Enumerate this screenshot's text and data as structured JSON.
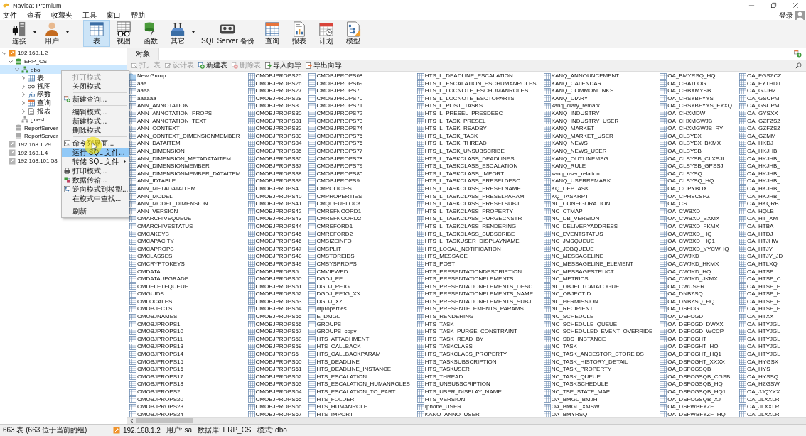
{
  "window": {
    "title": "Navicat Premium"
  },
  "menu_bar": [
    "文件",
    "查看",
    "收藏夹",
    "工具",
    "窗口",
    "帮助"
  ],
  "login": {
    "label": "登录"
  },
  "toolbar": {
    "groups": [
      [
        {
          "label": "连接",
          "dropdown": true,
          "selected": false
        },
        {
          "label": "用户",
          "dropdown": true,
          "selected": false
        }
      ],
      [
        {
          "label": "表",
          "dropdown": false,
          "selected": true
        },
        {
          "label": "视图",
          "dropdown": false,
          "selected": false
        },
        {
          "label": "函数",
          "dropdown": false,
          "selected": false
        },
        {
          "label": "其它",
          "dropdown": true,
          "selected": false
        },
        {
          "label": "SQL Server 备份",
          "dropdown": false,
          "selected": false
        },
        {
          "label": "查询",
          "dropdown": false,
          "selected": false
        },
        {
          "label": "报表",
          "dropdown": false,
          "selected": false
        },
        {
          "label": "计划",
          "dropdown": false,
          "selected": false
        },
        {
          "label": "模型",
          "dropdown": false,
          "selected": false
        }
      ]
    ]
  },
  "tree": {
    "items": [
      {
        "label": "192.168.1.2",
        "kind": "server",
        "connected": true,
        "expanded": true,
        "selected": false,
        "children": [
          {
            "label": "ERP_CS",
            "kind": "database",
            "connected": true,
            "expanded": true,
            "selected": false,
            "children": [
              {
                "label": "dbo",
                "kind": "schema",
                "connected": true,
                "expanded": true,
                "selected": true,
                "children": [
                  {
                    "label": "表",
                    "kind": "tables",
                    "expanded": false,
                    "selected": false
                  },
                  {
                    "label": "视图",
                    "kind": "views",
                    "expanded": false,
                    "selected": false
                  },
                  {
                    "label": "函数",
                    "kind": "functions",
                    "expanded": false,
                    "selected": false
                  },
                  {
                    "label": "查询",
                    "kind": "queries",
                    "expanded": false,
                    "selected": false
                  },
                  {
                    "label": "报表",
                    "kind": "reports",
                    "expanded": false,
                    "selected": false
                  }
                ]
              },
              {
                "label": "guest",
                "kind": "schema",
                "connected": false,
                "selected": false
              }
            ]
          },
          {
            "label": "ReportServer",
            "kind": "database",
            "connected": false,
            "selected": false
          },
          {
            "label": "ReportServer",
            "kind": "database",
            "connected": false,
            "selected": false
          }
        ]
      },
      {
        "label": "192.168.1.29",
        "kind": "server",
        "connected": false,
        "selected": false
      },
      {
        "label": "192.168.1.4",
        "kind": "server",
        "connected": false,
        "selected": false
      },
      {
        "label": "192.168.101.58",
        "kind": "server",
        "connected": false,
        "selected": false
      }
    ]
  },
  "context_menu": [
    {
      "kind": "item",
      "label": "打开模式",
      "disabled": true,
      "selected": false
    },
    {
      "kind": "item",
      "label": "关闭模式",
      "disabled": false,
      "selected": false
    },
    {
      "kind": "separator"
    },
    {
      "kind": "item",
      "label": "新建查询...",
      "disabled": false,
      "selected": false
    },
    {
      "kind": "separator"
    },
    {
      "kind": "item",
      "label": "编辑模式...",
      "disabled": false,
      "selected": false
    },
    {
      "kind": "item",
      "label": "新建模式...",
      "disabled": false,
      "selected": false
    },
    {
      "kind": "item",
      "label": "删除模式",
      "disabled": false,
      "selected": false
    },
    {
      "kind": "separator"
    },
    {
      "kind": "item",
      "label": "命令列界面...",
      "disabled": false,
      "selected": false
    },
    {
      "kind": "item",
      "label": "运行 SQL 文件...",
      "disabled": false,
      "selected": true
    },
    {
      "kind": "item",
      "label": "转储 SQL 文件",
      "submenu": true,
      "disabled": false,
      "selected": false
    },
    {
      "kind": "item",
      "label": "打印模式...",
      "disabled": false,
      "selected": false
    },
    {
      "kind": "item",
      "label": "数据传输...",
      "disabled": false,
      "selected": false
    },
    {
      "kind": "item",
      "label": "逆向模式到模型...",
      "disabled": false,
      "selected": false
    },
    {
      "kind": "item",
      "label": "在模式中查找...",
      "disabled": false,
      "selected": false
    },
    {
      "kind": "separator"
    },
    {
      "kind": "item",
      "label": "刷新",
      "disabled": false,
      "selected": false
    }
  ],
  "tabs": [
    {
      "label": "对象",
      "selected": true
    }
  ],
  "object_toolbar": [
    {
      "label": "打开表",
      "disabled": true
    },
    {
      "label": "设计表",
      "disabled": true
    },
    {
      "label": "新建表",
      "disabled": false
    },
    {
      "label": "删除表",
      "disabled": true
    },
    {
      "label": "导入向导",
      "disabled": false
    },
    {
      "label": "导出向导",
      "disabled": false
    }
  ],
  "objects": {
    "groups": [
      "New Group"
    ],
    "tables": [
      "aaa",
      "aaaa",
      "aaaaaa",
      "ANN_ANNOTATION",
      "ANN_ANNOTATION_PROPS",
      "ANN_ANNOTATION_TEXT",
      "ANN_CONTEXT",
      "ANN_CONTEXT_DIMENSIONMEMBER",
      "ANN_DATAITEM",
      "ANN_DIMENSION",
      "ANN_DIMENSION_METADATAITEM",
      "ANN_DIMENSIONMEMBER",
      "ANN_DIMENSIONMEMBER_DATAITEM",
      "ANN_IDTABLE",
      "ANN_METADATAITEM",
      "ANN_MODEL",
      "ANN_MODEL_DIMENSION",
      "ANN_VERSION",
      "CMARCHIVEQUEUE",
      "CMARCHIVESTATUS",
      "CMCAKEYS",
      "CMCAPACITY",
      "CMCAPROPS",
      "CMCLASSES",
      "CMCRYPTOKEYS",
      "CMDATA",
      "CMDATAUPGRADE",
      "CMDELETEQUEUE",
      "CMGUIDS",
      "CMLOCALES",
      "CMOBJECTS",
      "CMOBJNAMES",
      "CMOBJPROPS1",
      "CMOBJPROPS10",
      "CMOBJPROPS11",
      "CMOBJPROPS13",
      "CMOBJPROPS14",
      "CMOBJPROPS15",
      "CMOBJPROPS16",
      "CMOBJPROPS17",
      "CMOBJPROPS18",
      "CMOBJPROPS2",
      "CMOBJPROPS20",
      "CMOBJPROPS23",
      "CMOBJPROPS24",
      "CMOBJPROPS25",
      "CMOBJPROPS26",
      "CMOBJPROPS27",
      "CMOBJPROPS28",
      "CMOBJPROPS3",
      "CMOBJPROPS30",
      "CMOBJPROPS31",
      "CMOBJPROPS32",
      "CMOBJPROPS33",
      "CMOBJPROPS34",
      "CMOBJPROPS35",
      "CMOBJPROPS36",
      "CMOBJPROPS37",
      "CMOBJPROPS38",
      "CMOBJPROPS39",
      "CMOBJPROPS4",
      "CMOBJPROPS40",
      "CMOBJPROPS41",
      "CMOBJPROPS42",
      "CMOBJPROPS43",
      "CMOBJPROPS44",
      "CMOBJPROPS45",
      "CMOBJPROPS46",
      "CMOBJPROPS47",
      "CMOBJPROPS48",
      "CMOBJPROPS49",
      "CMOBJPROPS5",
      "CMOBJPROPS50",
      "CMOBJPROPS51",
      "CMOBJPROPS52",
      "CMOBJPROPS53",
      "CMOBJPROPS54",
      "CMOBJPROPS55",
      "CMOBJPROPS56",
      "CMOBJPROPS57",
      "CMOBJPROPS58",
      "CMOBJPROPS59",
      "CMOBJPROPS6",
      "CMOBJPROPS60",
      "CMOBJPROPS61",
      "CMOBJPROPS62",
      "CMOBJPROPS63",
      "CMOBJPROPS64",
      "CMOBJPROPS65",
      "CMOBJPROPS66",
      "CMOBJPROPS67",
      "CMOBJPROPS68",
      "CMOBJPROPS69",
      "CMOBJPROPS7",
      "CMOBJPROPS70",
      "CMOBJPROPS71",
      "CMOBJPROPS72",
      "CMOBJPROPS73",
      "CMOBJPROPS74",
      "CMOBJPROPS75",
      "CMOBJPROPS76",
      "CMOBJPROPS77",
      "CMOBJPROPS78",
      "CMOBJPROPS79",
      "CMOBJPROPS80",
      "CMOBJPROPS9",
      "CMPOLICIES",
      "CMPROPERTIES",
      "CMQUEUELOCK",
      "CMREFNOORD1",
      "CMREFNOORD2",
      "CMREFORD1",
      "CMREFORD2",
      "CMSIZEINFO",
      "CMSPLIT",
      "CMSTOREIDS",
      "CMSYSPROPS",
      "CMVIEWED",
      "DGDJ_PF",
      "DGDJ_PFJG",
      "DGDJ_PFJG_XX",
      "DGDJ_XZ",
      "dtproperties",
      "E_DMGL",
      "GROUPS",
      "GROUPS_copy",
      "HTS_ATTACHMENT",
      "HTS_CALLBACK",
      "HTS_CALLBACKPARAM",
      "HTS_DEADLINE",
      "HTS_DEADLINE_INSTANCE",
      "HTS_ESCALATION",
      "HTS_ESCALATION_HUMANROLES",
      "HTS_ESCALATION_TO_PART",
      "HTS_FOLDER",
      "HTS_HUMANROLE",
      "HTS_IMPORT",
      "HTS_L_DEADLINE_ESCALATION",
      "HTS_L_ESCALATION_ESCHUMANROLES",
      "HTS_L_LOCNOTE_ESCHUMANROLES",
      "HTS_L_LOCNOTE_ESCTOPARTS",
      "HTS_L_POST_TASKS",
      "HTS_L_PRESEL_PRESDESC",
      "HTS_L_TASK_PRESEL",
      "HTS_L_TASK_READBY",
      "HTS_L_TASK_TASK",
      "HTS_L_TASK_THREAD",
      "HTS_L_TASK_UNSUBSCRIBE",
      "HTS_L_TASKCLASS_DEADLINES",
      "HTS_L_TASKCLASS_ESCALATION",
      "HTS_L_TASKCLASS_IMPORT",
      "HTS_L_TASKCLASS_PRESELDESC",
      "HTS_L_TASKCLASS_PRESELNAME",
      "HTS_L_TASKCLASS_PRESELPARAM",
      "HTS_L_TASKCLASS_PRESELSUBJ",
      "HTS_L_TASKCLASS_PROPERTY",
      "HTS_L_TASKCLASS_PURGECNSTR",
      "HTS_L_TASKCLASS_RENDERING",
      "HTS_L_TASKCLASS_SUBSCRIBE",
      "HTS_L_TASKUSER_DISPLAYNAME",
      "HTS_LOCAL_NOTIFICATION",
      "HTS_MESSAGE",
      "HTS_POST",
      "HTS_PRESENTATIONDESCRIPTION",
      "HTS_PRESENTATIONELEMENTS",
      "HTS_PRESENTATIONELEMENTS_DESC",
      "HTS_PRESENTATIONELEMENTS_NAME",
      "HTS_PRESENTATIONELEMENTS_SUBJ",
      "HTS_PRESENTELEMENTS_PARAMS",
      "HTS_RENDERING",
      "HTS_TASK",
      "HTS_TASK_PURGE_CONSTRAINT",
      "HTS_TASK_READ_BY",
      "HTS_TASKCLASS",
      "HTS_TASKCLASS_PROPERTY",
      "HTS_TASKSUBSCRIPTION",
      "HTS_TASKUSER",
      "HTS_THREAD",
      "HTS_UNSUBSCRIPTION",
      "HTS_USER_DISPLAY_NAME",
      "HTS_VERSION",
      "Iphone_USER",
      "KANQ_ANNO_USER",
      "KANQ_ANNOUNCEMENT",
      "KANQ_CALENDAR",
      "KANQ_COMMONLINKS",
      "KANQ_DIARY",
      "kanq_diary_remark",
      "KANQ_INDUSTRY",
      "KANQ_INDUSTRY_USER",
      "KANQ_MARKET",
      "KANQ_MARKET_USER",
      "KANQ_NEWS",
      "KANQ_NEWS_USER",
      "KANQ_OUTLINEMSG",
      "KANQ_RULE",
      "kanq_user_relation",
      "KANQ_USERREMARK",
      "KQ_DEPTASK",
      "KQ_TASKRPT",
      "NC_CONFIGURATION",
      "NC_CTMAP",
      "NC_DB_VERSION",
      "NC_DELIVERYADDRESS",
      "NC_EVENTSTATUS",
      "NC_JMSQUEUE",
      "NC_JOBQUEUE",
      "NC_MESSAGELINE",
      "NC_MESSAGELINE_ELEMENT",
      "NC_MESSAGESTRUCT",
      "NC_METRICS",
      "NC_OBJECTCATALOGUE",
      "NC_OBJECTID",
      "NC_PERMISSION",
      "NC_RECIPIENT",
      "NC_SCHEDULE",
      "NC_SCHEDULE_QUEUE",
      "NC_SCHEDULED_EVENT_OVERRIDE",
      "NC_SDS_INSTANCE",
      "NC_TASK",
      "NC_TASK_ANCESTOR_STOREIDS",
      "NC_TASK_HISTORY_DETAIL",
      "NC_TASK_PROPERTY",
      "NC_TASK_QUEUE",
      "NC_TASKSCHEDULE",
      "NC_TSE_STATE_MAP",
      "OA_BMGL_BMJH",
      "OA_BMGL_XMSW",
      "OA_BMYRSQ",
      "OA_BMYRSQ_HQ",
      "OA_CHATLOG",
      "OA_CHBXMYSB",
      "OA_CHSYBFYYS",
      "OA_CHSYBFYYS_FYXQ",
      "OA_CHXMDW",
      "OA_CHXMGWJB",
      "OA_CHXMGWJB_RY",
      "OA_CLSYBX",
      "OA_CLSYBX_BXMX",
      "OA_CLSYSB",
      "OA_CLSYSB_CLXSJL",
      "OA_CLSYSB_GPSSJ",
      "OA_CLSYSQ",
      "OA_CLSYSQ_HQ",
      "OA_COPYBOX",
      "OA_CPHSCSPZ",
      "OA_CS",
      "OA_CWBXD",
      "OA_CWBXD_BXMX",
      "OA_CWBXD_FKMX",
      "OA_CWBXD_HQ",
      "OA_CWBXD_HQ1",
      "OA_CWBXD_YYCWHQ",
      "OA_CWJKD",
      "OA_CWJKD_HKMX",
      "OA_CWJKD_HQ",
      "OA_CWJKD_JKMX",
      "OA_CWUSER",
      "OA_DNBZSQ",
      "OA_DNBZSQ_HQ",
      "OA_DSFCG",
      "OA_DSFCGD",
      "OA_DSFCGD_DWXX",
      "OA_DSFCGD_WCCP",
      "OA_DSFCGHT",
      "OA_DSFCGHT_HQ",
      "OA_DSFCGHT_HQ1",
      "OA_DSFCGHT_XXXX",
      "OA_DSFCGSQB",
      "OA_DSFCGSQB_CGSB",
      "OA_DSFCGSQB_HQ",
      "OA_DSFCGSQB_HQ1",
      "OA_DSFCGSQB_XJ",
      "OA_DSFWBFYZF",
      "OA_DSFWBFYZF_HQ",
      "OA_FGSZCZ",
      "OA_FYTHDJ",
      "OA_GJJHZ",
      "OA_GSCPM",
      "OA_GSCPM",
      "OA_GYSXX",
      "OA_GZFZSZ",
      "OA_GZFZSZ",
      "OA_GZMM",
      "OA_HKDJ",
      "OA_HKJHB",
      "OA_HKJHB_",
      "OA_HKJHB_",
      "OA_HKJHB_",
      "OA_HKJHB_",
      "OA_HKJHB_",
      "OA_HKJHB_",
      "OA_HKQRB",
      "OA_HQLB",
      "OA_HT_XM",
      "OA_HTBA",
      "OA_HTDJ",
      "OA_HTJHW",
      "OA_HTJY",
      "OA_HTJY_JD",
      "OA_HTLXQ",
      "OA_HTSP",
      "OA_HTSP_C",
      "OA_HTSP_F",
      "OA_HTSP_H",
      "OA_HTSP_H",
      "OA_HTSP_H",
      "OA_HTXX",
      "OA_HTYJGL",
      "OA_HTYJGL",
      "OA_HTYJGL",
      "OA_HTYJGL",
      "OA_HTYJGL",
      "OA_HYGSX",
      "OA_HYS",
      "OA_HYSSQ",
      "OA_HZGSW",
      "OA_JJQYXX",
      "OA_JLXXLR",
      "OA_JLXXLR",
      "OA_JLXXLR"
    ]
  },
  "status_bar": {
    "count": "663 表 (663 位于当前的组)",
    "connection": "192.168.1.2",
    "user": "用户: sa",
    "database": "数据库: ERP_CS",
    "schema": "模式: dbo"
  }
}
